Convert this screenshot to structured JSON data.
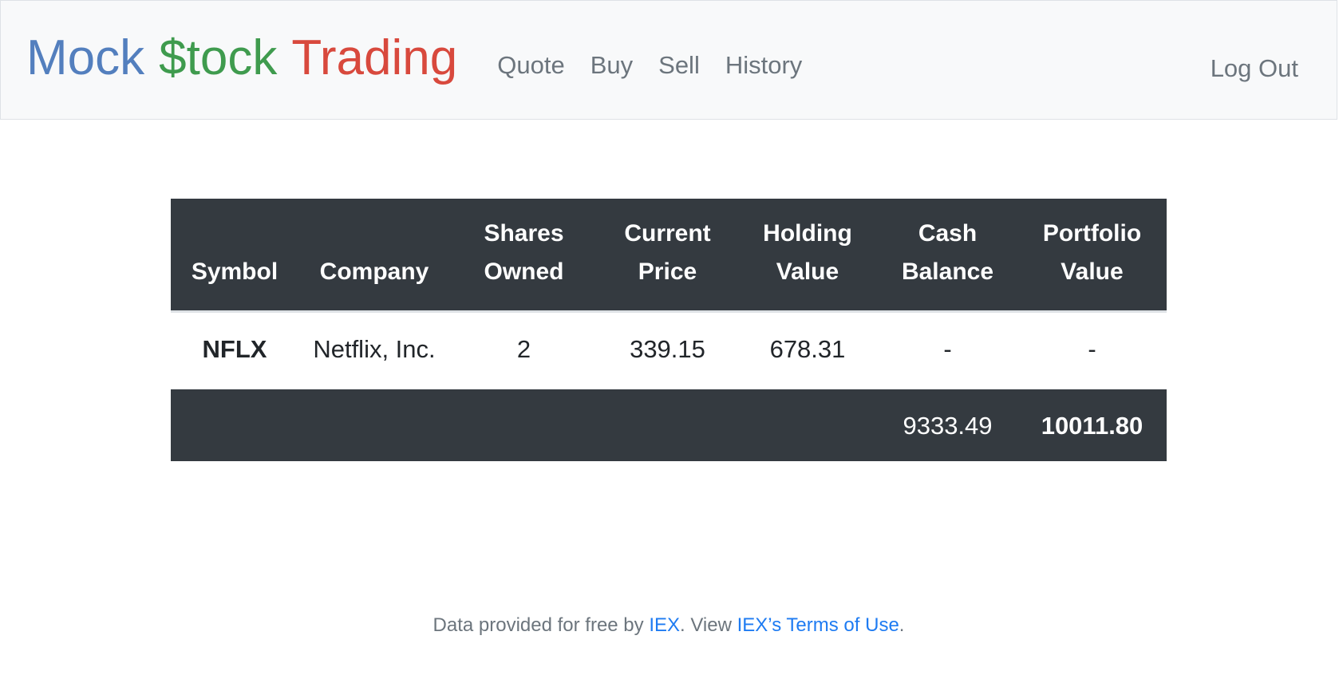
{
  "brand": {
    "part1": "Mock",
    "part2": "$tock",
    "part3": "Trading",
    "colors": {
      "part1": "#537fbe",
      "part2": "#3f9b4e",
      "part3": "#d8493d"
    }
  },
  "nav": {
    "items": [
      {
        "label": "Quote"
      },
      {
        "label": "Buy"
      },
      {
        "label": "Sell"
      },
      {
        "label": "History"
      }
    ],
    "logout": "Log Out"
  },
  "table": {
    "headers": {
      "symbol": "Symbol",
      "company": "Company",
      "shares_l1": "Shares",
      "shares_l2": "Owned",
      "price_l1": "Current",
      "price_l2": "Price",
      "holding_l1": "Holding",
      "holding_l2": "Value",
      "cash_l1": "Cash",
      "cash_l2": "Balance",
      "portfolio_l1": "Portfolio",
      "portfolio_l2": "Value"
    },
    "rows": [
      {
        "symbol": "NFLX",
        "company": "Netflix, Inc.",
        "shares": "2",
        "price": "339.15",
        "holding": "678.31",
        "cash": "-",
        "portfolio": "-"
      }
    ],
    "footer": {
      "cash_balance": "9333.49",
      "portfolio_value": "10011.80"
    },
    "header_color": "#343a40"
  },
  "footer": {
    "text_before": "Data provided for free by ",
    "link1": "IEX",
    "text_middle": ". View ",
    "link2": "IEX’s Terms of Use",
    "text_after": ".",
    "link_color": "#1e7bf2"
  }
}
